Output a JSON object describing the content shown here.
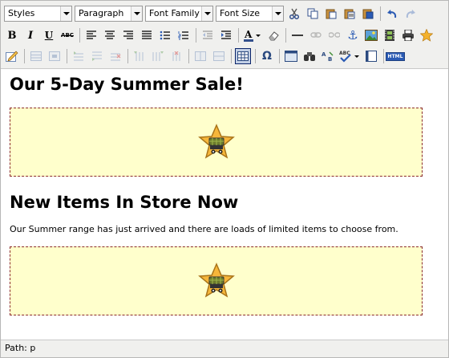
{
  "toolbar": {
    "styles_label": "Styles",
    "format_label": "Paragraph",
    "fontfamily_label": "Font Family",
    "fontsize_label": "Font Size",
    "bold": "B",
    "italic": "I",
    "underline": "U",
    "strike": "ABC",
    "html": "HTML",
    "anchor": "⚓",
    "charmap": "Ω",
    "spell": "ABC"
  },
  "content": {
    "heading1": "Our 5-Day Summer Sale!",
    "heading2": "New Items In Store Now",
    "paragraph": "Our Summer range has just arrived and there are loads of limited items to choose from.",
    "banner_icon": "shopping-star-icon"
  },
  "statusbar": {
    "path": "Path: p"
  }
}
